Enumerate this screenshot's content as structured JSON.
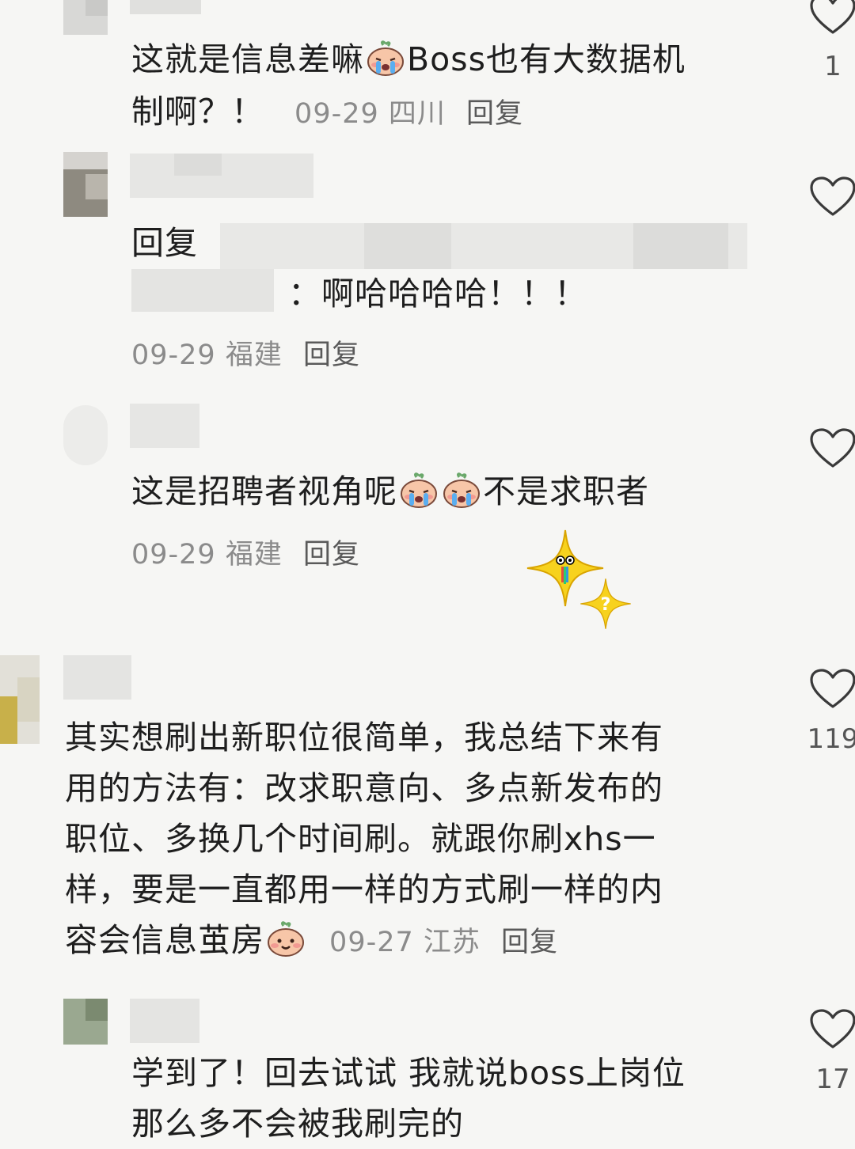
{
  "comments": [
    {
      "text_line1": "这就是信息差嘛",
      "text_line1b": "Boss也有大数据机",
      "text_line2": "制啊？！",
      "date": "09-29",
      "location": "四川",
      "reply": "回复",
      "likes": "1"
    },
    {
      "prefix": "回复",
      "text": "：啊哈哈哈哈！！！",
      "date": "09-29",
      "location": "福建",
      "reply": "回复"
    },
    {
      "text_a": "这是招聘者视角呢",
      "text_b": "不是求职者",
      "date": "09-29",
      "location": "福建",
      "reply": "回复"
    },
    {
      "lines": [
        "其实想刷出新职位很简单，我总结下来有",
        "用的方法有：改求职意向、多点新发布的",
        "职位、多换几个时间刷。就跟你刷xhs一",
        "样，要是一直都用一样的方式刷一样的内"
      ],
      "last_line": "容会信息茧房",
      "date": "09-27",
      "location": "江苏",
      "reply": "回复",
      "likes": "119"
    },
    {
      "lines": [
        "学到了！回去试试 我就说boss上岗位",
        "那么多不会被我刷完的"
      ],
      "likes": "17"
    }
  ],
  "icons": {
    "like": "heart-outline-icon",
    "emoji_cry": "crying-peach-emoji",
    "emoji_smile": "smiling-peach-emoji",
    "sticker": "star-sticker"
  },
  "colors": {
    "text": "#1e1e1e",
    "meta": "#8b8b8b",
    "background": "#f6f6f4"
  }
}
